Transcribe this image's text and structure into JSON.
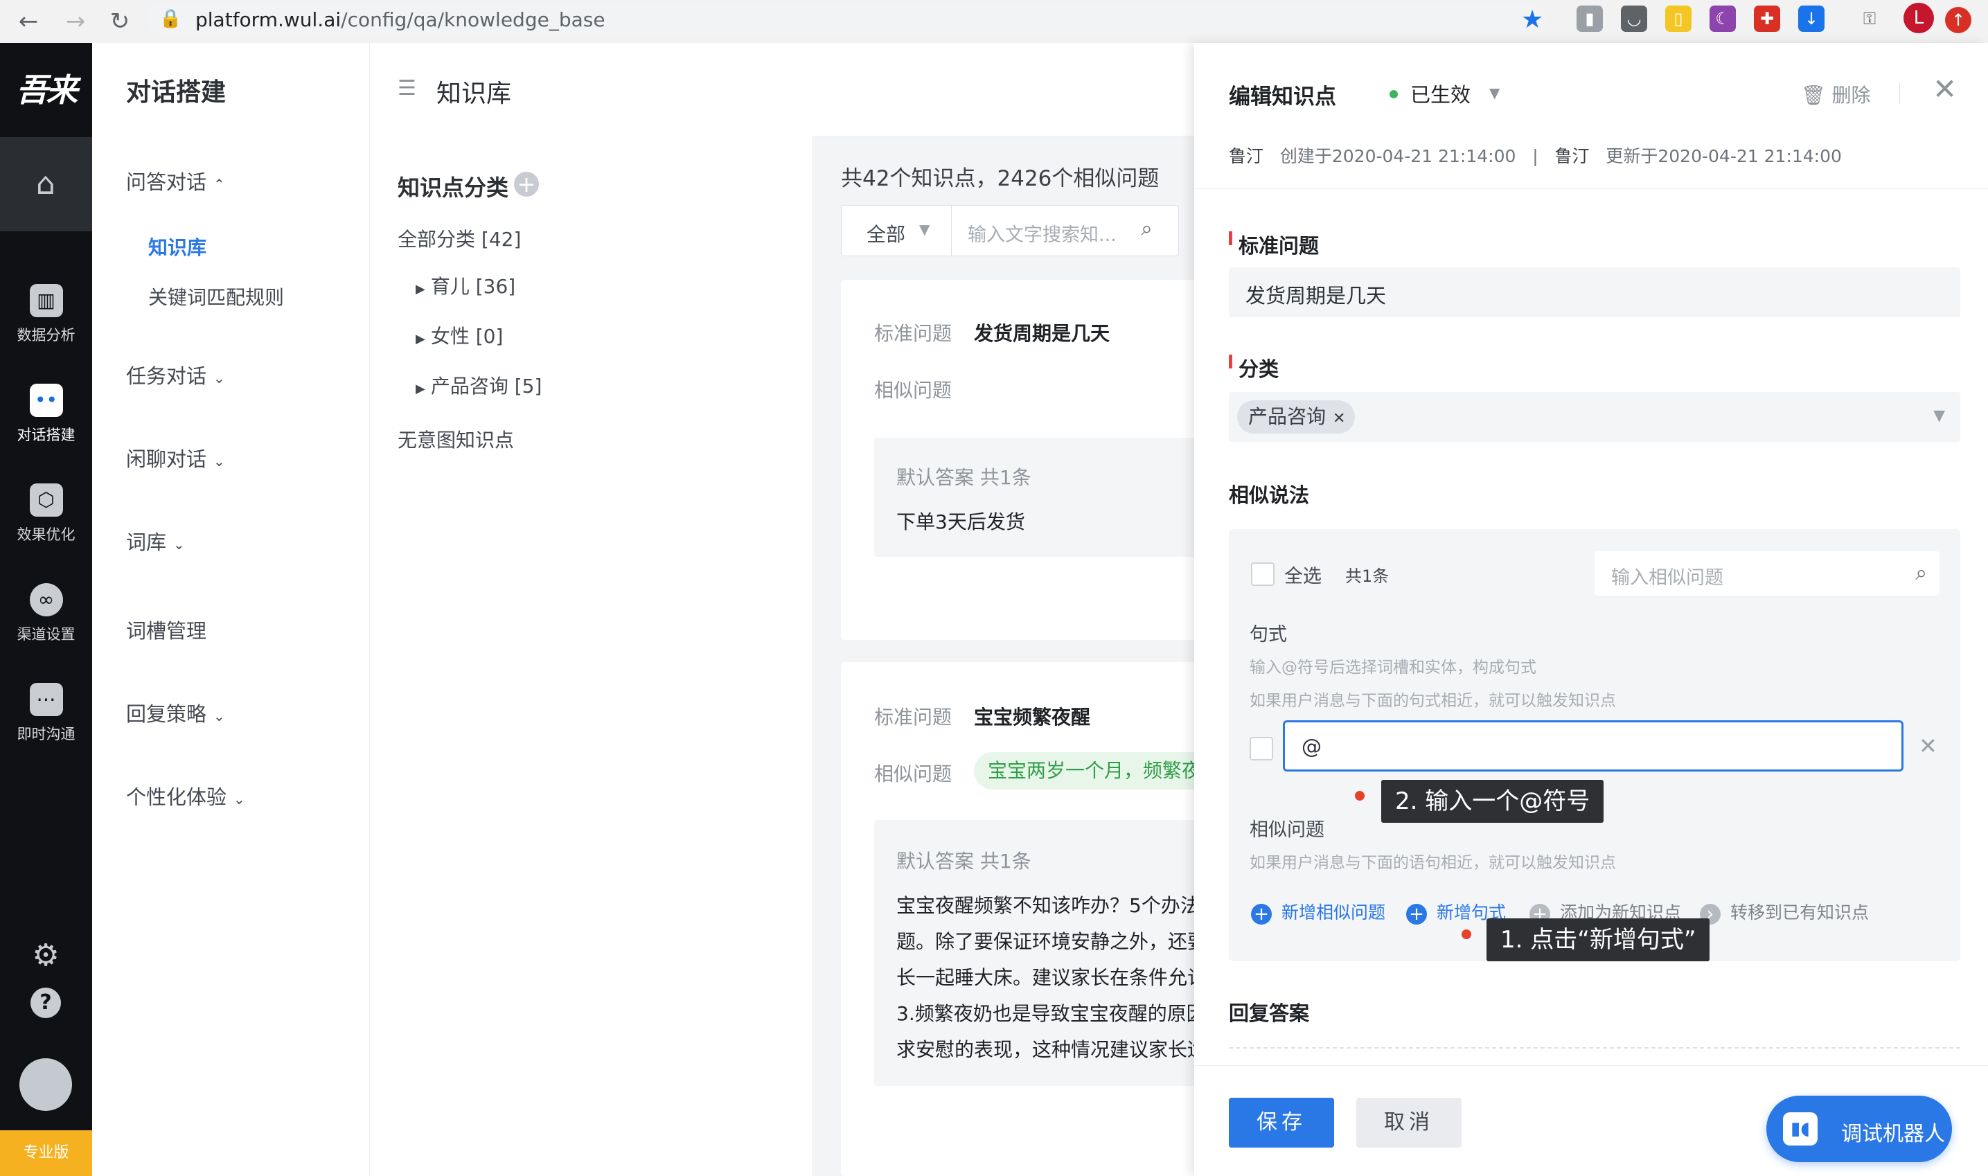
{
  "browser": {
    "url_host": "platform.wul.ai",
    "url_path": "/config/qa/knowledge_base",
    "profile_initial": "L",
    "icons": [
      "back-icon",
      "forward-icon",
      "reload-icon",
      "lock-icon",
      "bookmark-star-icon",
      "key-icon"
    ]
  },
  "rail": {
    "logo": "吾来",
    "items": [
      {
        "label": "数据分析",
        "icon": "chart-icon"
      },
      {
        "label": "对话搭建",
        "icon": "robot-icon"
      },
      {
        "label": "效果优化",
        "icon": "cube-icon"
      },
      {
        "label": "渠道设置",
        "icon": "channel-icon"
      },
      {
        "label": "即时沟通",
        "icon": "chat-icon"
      }
    ],
    "settings_icon": "gear-icon",
    "help_icon": "question-icon",
    "badge": "专业版"
  },
  "sidebar": {
    "title": "对话搭建",
    "groups": [
      {
        "label": "问答对话",
        "chevron": "^"
      },
      {
        "label": "任务对话",
        "chevron": "v"
      },
      {
        "label": "闲聊对话",
        "chevron": "v"
      },
      {
        "label": "词库",
        "chevron": "v"
      },
      {
        "label": "词槽管理",
        "chevron": ""
      },
      {
        "label": "回复策略",
        "chevron": "v"
      },
      {
        "label": "个性化体验",
        "chevron": "v"
      }
    ],
    "sub_items": [
      {
        "label": "知识库",
        "active": true
      },
      {
        "label": "关键词匹配规则",
        "active": false
      }
    ]
  },
  "header": {
    "title": "知识库"
  },
  "categories": {
    "title": "知识点分类",
    "all": "全部分类  [42]",
    "items": [
      "育儿  [36]",
      "女性  [0]",
      "产品咨询  [5]"
    ],
    "no_intent": "无意图知识点"
  },
  "list": {
    "summary": "共42个知识点，2426个相似问题",
    "filter_all": "全部",
    "search_placeholder": "输入文字搜索知...",
    "cards": [
      {
        "std_label": "标准问题",
        "std_q": "发货周期是几天",
        "sim_label": "相似问题",
        "sim_tag": "",
        "ans_title": "默认答案  共1条",
        "ans_lines": [
          "下单3天后发货"
        ]
      },
      {
        "std_label": "标准问题",
        "std_q": "宝宝频繁夜醒",
        "sim_label": "相似问题",
        "sim_tag": "宝宝两岁一个月，频繁夜",
        "ans_title": "默认答案  共1条",
        "ans_lines": [
          "宝宝夜醒频繁不知该咋办？5个办法",
          "题。除了要保证环境安静之外，还要",
          "长一起睡大床。建议家长在条件允许",
          "3.频繁夜奶也是导致宝宝夜醒的原因",
          "求安慰的表现，这种情况建议家长适"
        ]
      }
    ]
  },
  "drawer": {
    "title": "编辑知识点",
    "status": "已生效",
    "status_color": "#3cb55c",
    "delete": "删除",
    "meta": {
      "creator": "鲁汀",
      "created": "创建于2020-04-21 21:14:00",
      "sep": "|",
      "updater": "鲁汀",
      "updated": "更新于2020-04-21 21:14:00"
    },
    "std_label": "标准问题",
    "std_value": "发货周期是几天",
    "cat_label": "分类",
    "cat_chip": "产品咨询",
    "sim_label": "相似说法",
    "select_all": "全选",
    "count": "共1条",
    "sim_search_placeholder": "输入相似问题",
    "pattern_title": "句式",
    "pattern_hint1": "输入@符号后选择词槽和实体，构成句式",
    "pattern_hint2": "如果用户消息与下面的句式相近，就可以触发知识点",
    "pattern_value": "@",
    "tip2": "2. 输入一个@符号",
    "simq_title": "相似问题",
    "simq_hint": "如果用户消息与下面的语句相近，就可以触发知识点",
    "actions": {
      "add_sim": "新增相似问题",
      "add_pattern": "新增句式",
      "add_new": "添加为新知识点",
      "move": "转移到已有知识点"
    },
    "tip1": "1. 点击“新增句式”",
    "reply_label": "回复答案",
    "save": "保存",
    "cancel": "取消",
    "robot": "调试机器人",
    "accent": "#2a77e6"
  }
}
